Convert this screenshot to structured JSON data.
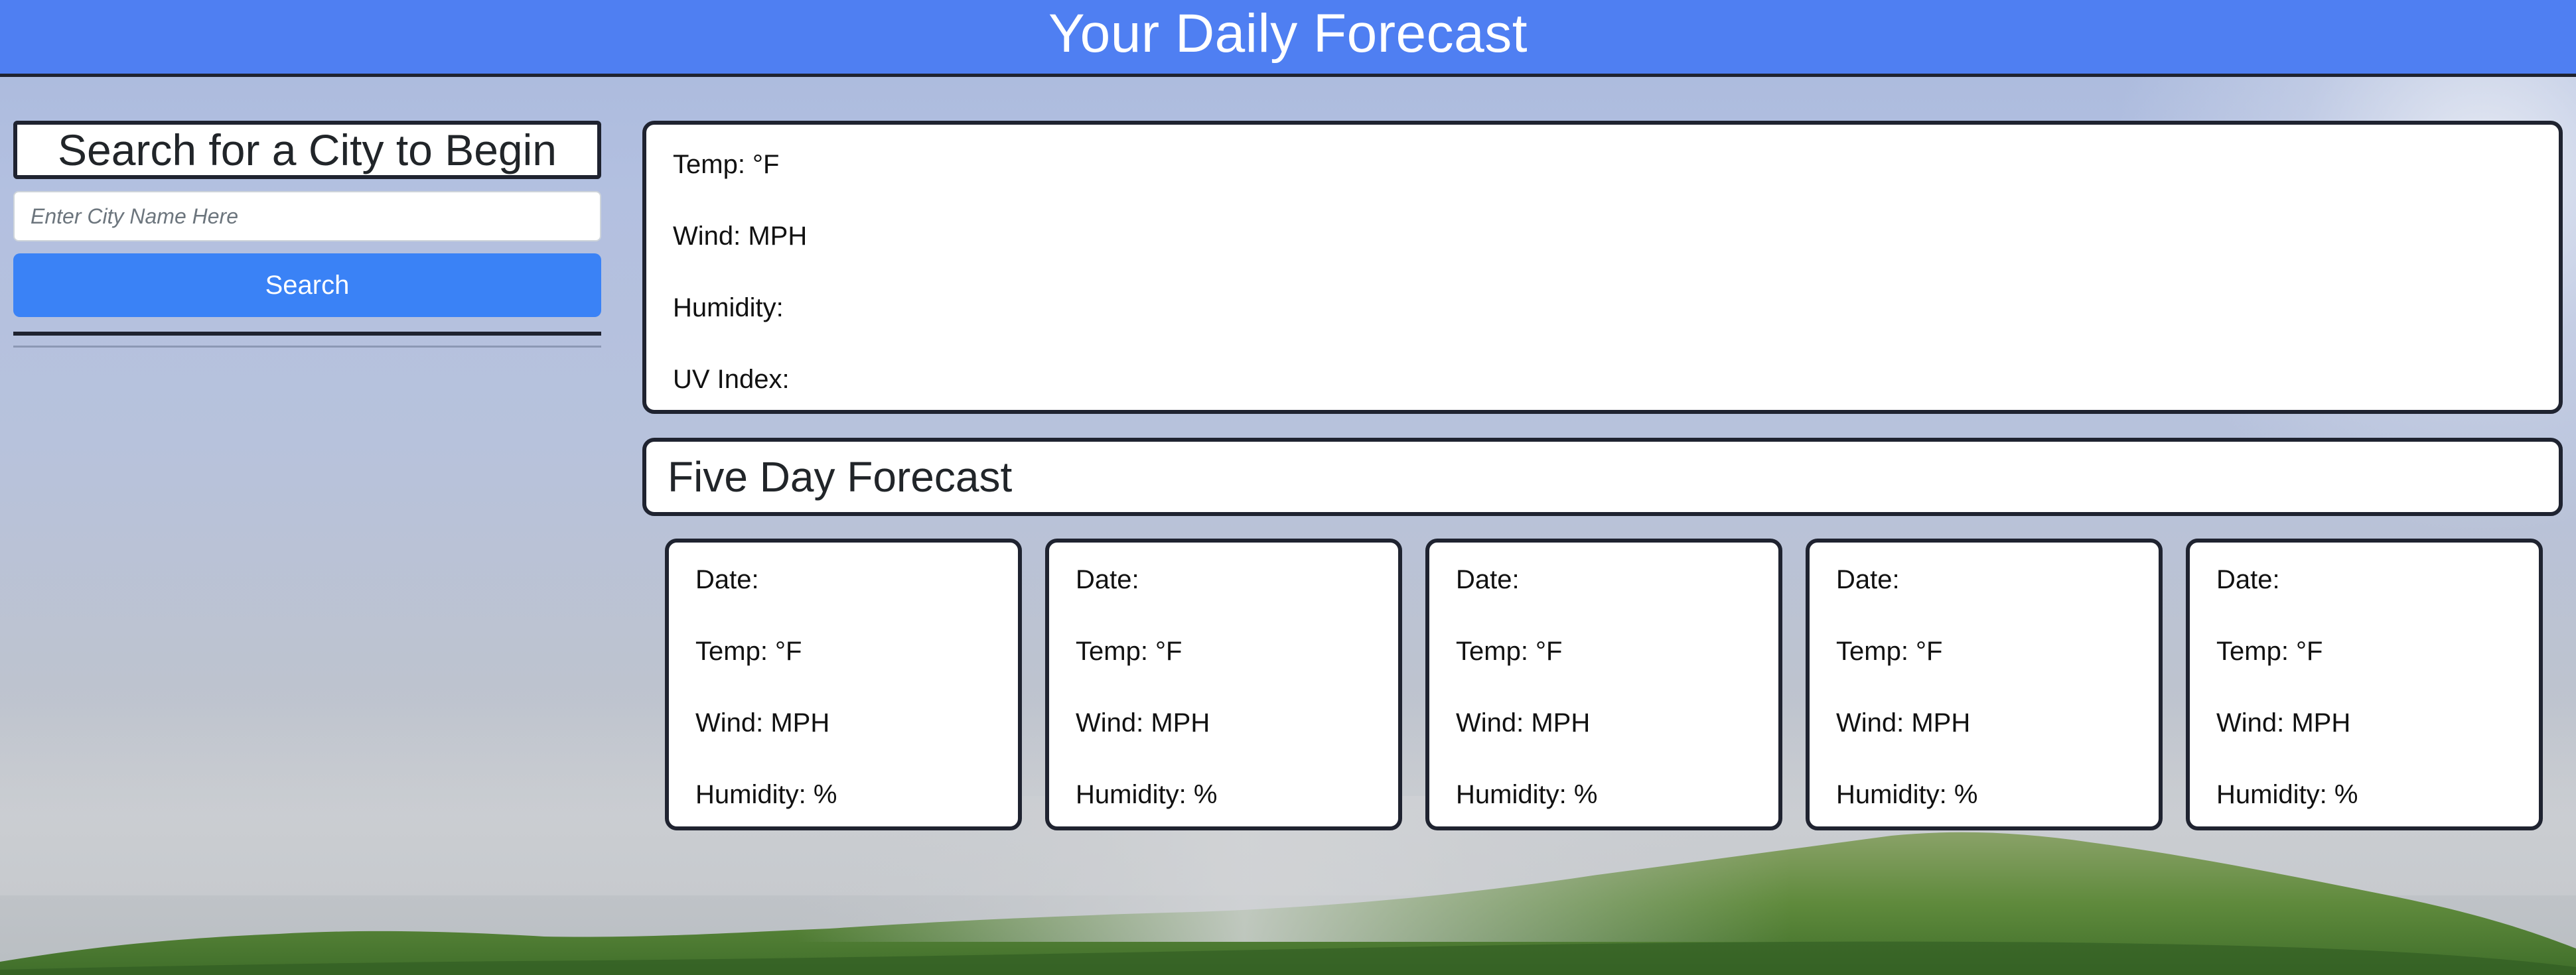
{
  "header": {
    "title": "Your Daily Forecast"
  },
  "search": {
    "title": "Search for a City to Begin",
    "placeholder": "Enter City Name Here",
    "button_label": "Search"
  },
  "current": {
    "temp": "Temp: °F",
    "wind": "Wind: MPH",
    "humidity": "Humidity:",
    "uv": "UV Index:"
  },
  "forecast": {
    "title": "Five Day Forecast",
    "days": [
      {
        "date": "Date:",
        "temp": "Temp: °F",
        "wind": "Wind: MPH",
        "humidity": "Humidity: %"
      },
      {
        "date": "Date:",
        "temp": "Temp: °F",
        "wind": "Wind: MPH",
        "humidity": "Humidity: %"
      },
      {
        "date": "Date:",
        "temp": "Temp: °F",
        "wind": "Wind: MPH",
        "humidity": "Humidity: %"
      },
      {
        "date": "Date:",
        "temp": "Temp: °F",
        "wind": "Wind: MPH",
        "humidity": "Humidity: %"
      },
      {
        "date": "Date:",
        "temp": "Temp: °F",
        "wind": "Wind: MPH",
        "humidity": "Humidity: %"
      }
    ]
  },
  "colors": {
    "header_bg": "#4f7ff2",
    "button_bg": "#3a82f6",
    "border": "#1f2330"
  }
}
